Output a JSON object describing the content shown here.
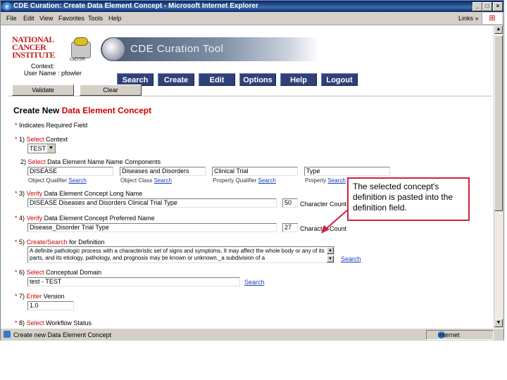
{
  "window": {
    "title": "CDE Curation: Create Data Element Concept - Microsoft Internet Explorer",
    "minimize": "_",
    "maximize": "□",
    "close": "×"
  },
  "menu": [
    "File",
    "Edit",
    "View",
    "Favorites",
    "Tools",
    "Help"
  ],
  "links_label": "Links",
  "header": {
    "logo_lines": [
      "NATIONAL",
      "CANCER",
      "INSTITUTE"
    ],
    "cadsr_label": "caDSR",
    "tool_title": "CDE Curation Tool",
    "context_label": "Context:",
    "user_label": "User Name : pfowler"
  },
  "nav": [
    "Search",
    "Create",
    "Edit",
    "Options",
    "Help",
    "Logout"
  ],
  "actions": {
    "validate": "Validate",
    "clear": "Clear"
  },
  "form": {
    "title_prefix": "Create New",
    "title_highlight": "Data Element Concept",
    "required_note": "Indicates Required Field",
    "q1": {
      "num": "1)",
      "verb": "Select",
      "label": "Context",
      "value": "TEST"
    },
    "q2": {
      "num": "2)",
      "verb": "Select",
      "label": "Data Element Name Name Components",
      "fields": [
        {
          "value": "DISEASE",
          "caption": "Object Qualifier",
          "link": "Search"
        },
        {
          "value": "Diseases and Disorders",
          "caption": "Object Class",
          "link": "Search"
        },
        {
          "value": "Clinical Trial",
          "caption": "Property Qualifier",
          "link": "Search"
        },
        {
          "value": "Type",
          "caption": "Property",
          "link": "Search"
        }
      ]
    },
    "q3": {
      "num": "3)",
      "verb": "Verify",
      "label": "Data Element Concept Long Name",
      "value": "DISEASE Diseases and Disorders Clinical Trial Type",
      "count": "50",
      "count_label": "Character Count"
    },
    "q4": {
      "num": "4)",
      "verb": "Verify",
      "label": "Data Element Concept Preferred Name",
      "value": "Disease_Disorder Trial Type",
      "count": "27",
      "count_label": "Character Count"
    },
    "q5": {
      "num": "5)",
      "verb": "Create/Search",
      "label": "for Definition",
      "value": "A definite pathologic process with a characteristic set of signs and symptoms. It may affect the whole body or any of its parts, and its etiology, pathology, and prognosis may be known or unknown._a subdivision of a",
      "link": "Search"
    },
    "q6": {
      "num": "6)",
      "verb": "Select",
      "label": "Conceptual Domain",
      "value": "test - TEST",
      "link": "Search"
    },
    "q7": {
      "num": "7)",
      "verb": "Enter",
      "label": "Version",
      "value": "1.0"
    },
    "q8": {
      "num": "8)",
      "verb": "Select",
      "label": "Workflow Status"
    }
  },
  "callout": "The selected concept's definition is pasted into the definition field.",
  "status": {
    "text": "Create new Data Element Concept",
    "zone": "Internet"
  },
  "colors": {
    "accent_red": "#cc0000",
    "nav_blue": "#30407a",
    "callout_border": "#cc2244",
    "link": "#1a3dbb"
  }
}
